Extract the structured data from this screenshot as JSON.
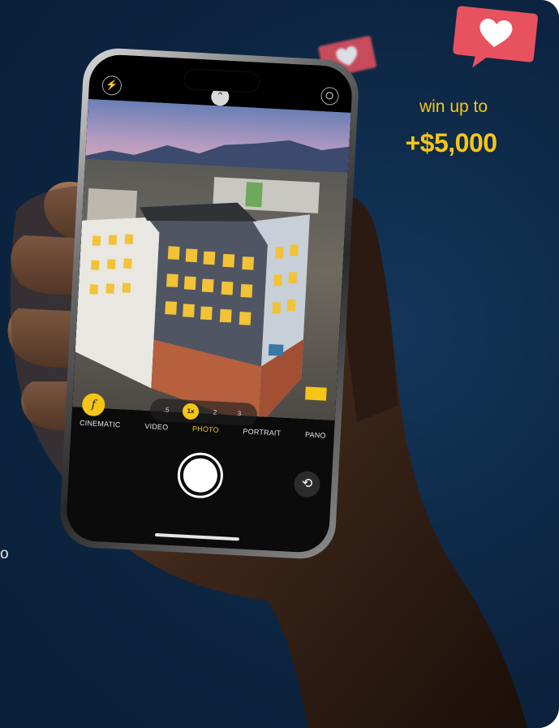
{
  "promo": {
    "line1": "win up to",
    "amount": "+$5,000",
    "accent_color": "#f5c518",
    "edge_fragment": "o"
  },
  "background_color": "#0c2440",
  "camera": {
    "zoom_levels": [
      ".5",
      "1x",
      "2",
      "3"
    ],
    "active_zoom": "1x",
    "modes": [
      "CINEMATIC",
      "VIDEO",
      "PHOTO",
      "PORTRAIT",
      "PANO"
    ],
    "active_mode": "PHOTO",
    "aperture_label": "f",
    "icons": {
      "flash": "flash-icon",
      "chevron": "chevron-up-icon",
      "live": "live-photo-icon",
      "shutter": "shutter-button",
      "flip": "camera-flip-icon"
    }
  },
  "decorations": {
    "like_icon": "heart-icon",
    "like_color": "#e8525e"
  }
}
